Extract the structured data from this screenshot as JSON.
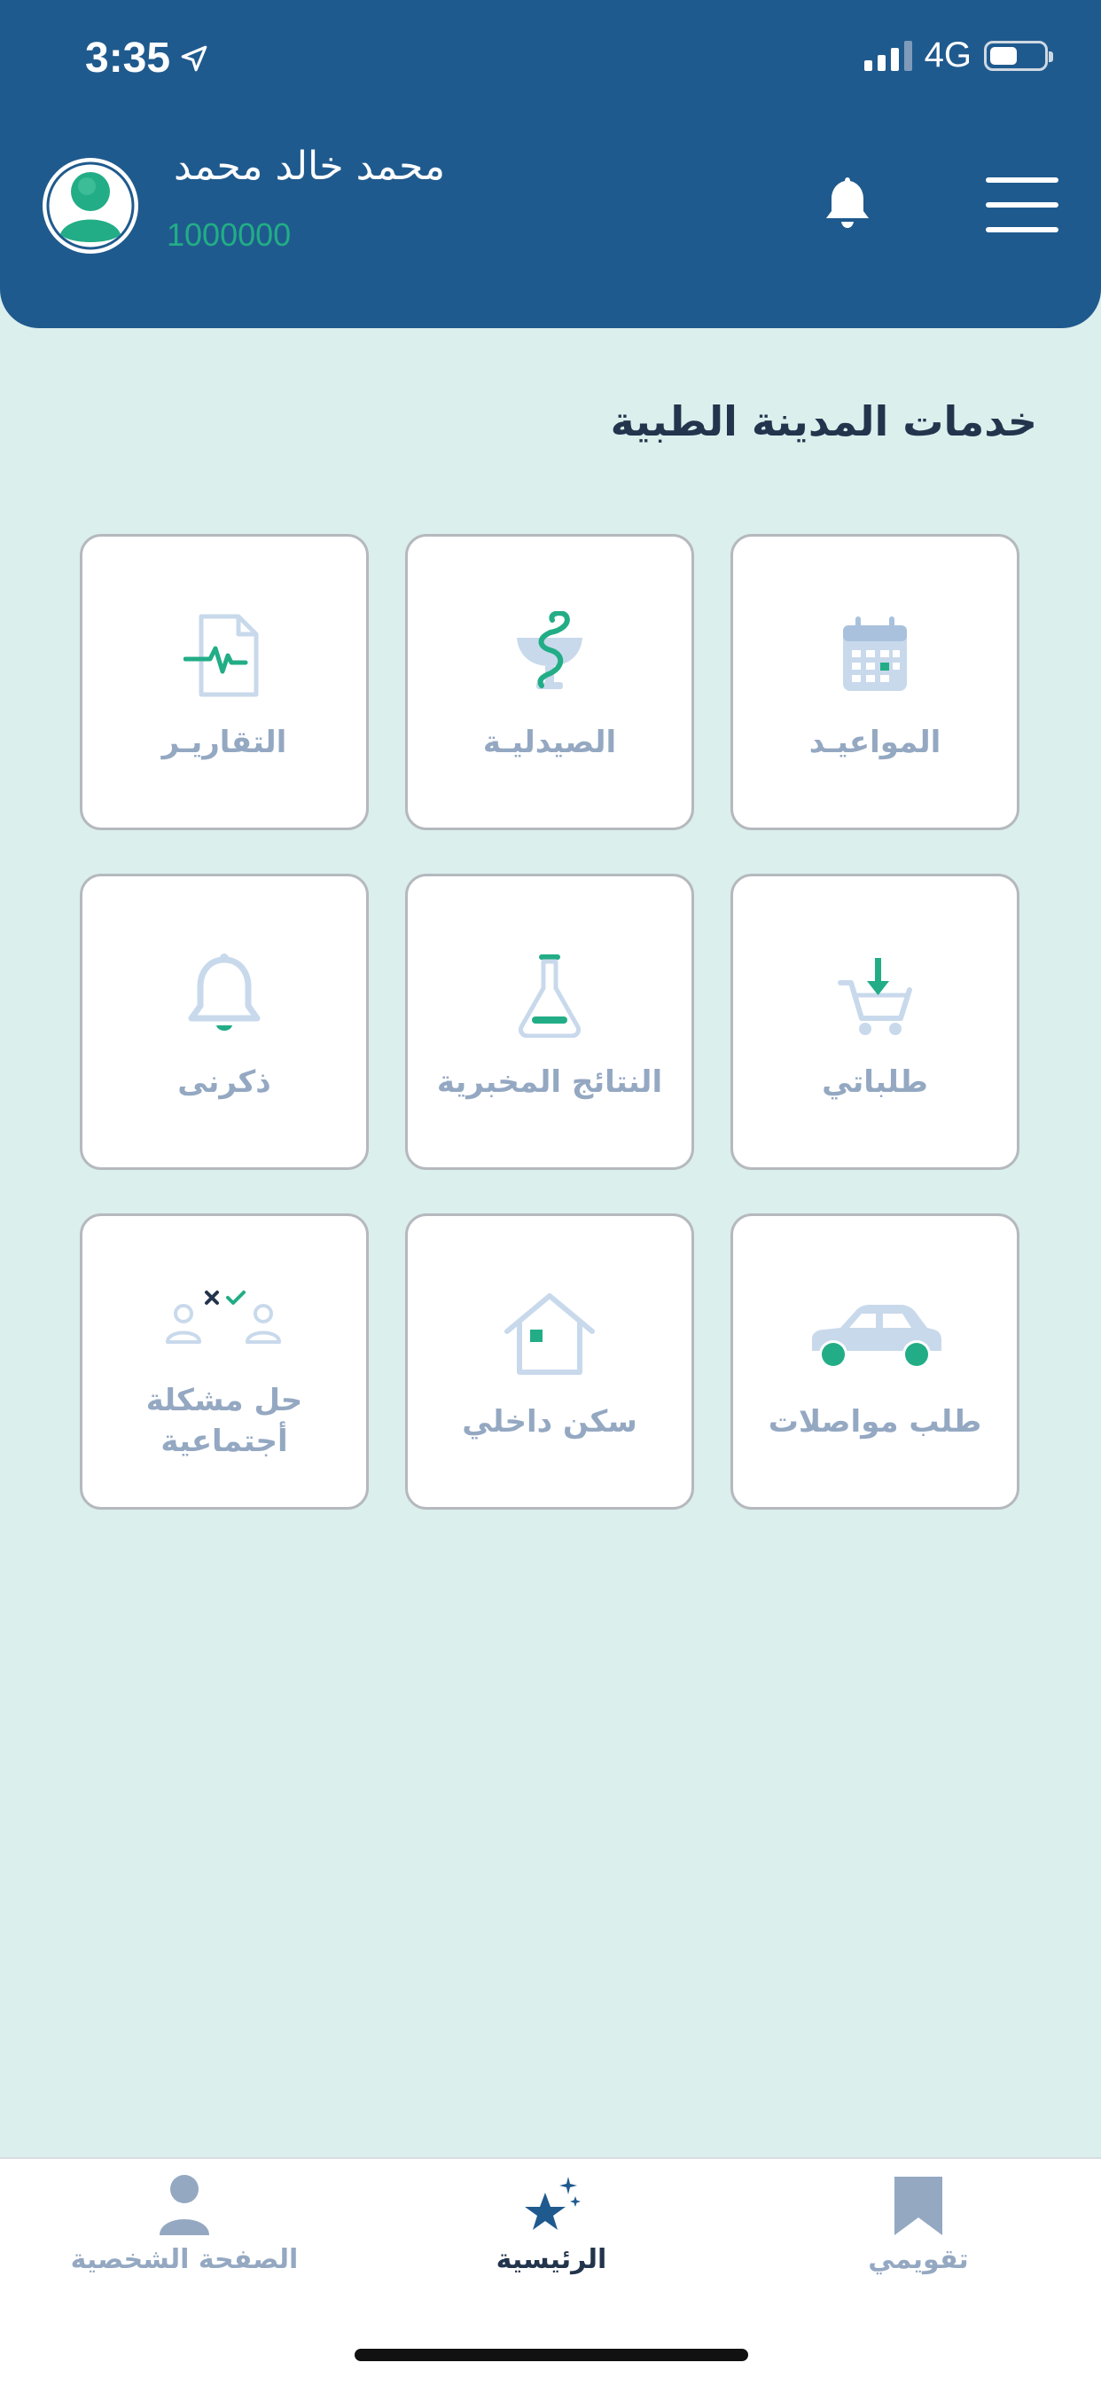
{
  "status_bar": {
    "time": "3:35",
    "network": "4G"
  },
  "header": {
    "user_name": "محمد خالد محمد",
    "user_id": "1000000"
  },
  "section_title": "خدمات المدينة الطبية",
  "services": [
    {
      "label": "المواعيـد",
      "icon": "calendar-icon"
    },
    {
      "label": "الصيدليـة",
      "icon": "pharmacy-icon"
    },
    {
      "label": "التقاريـر",
      "icon": "report-icon"
    },
    {
      "label": "طلباتي",
      "icon": "cart-icon"
    },
    {
      "label": "النتائج المخبرية",
      "icon": "lab-flask-icon"
    },
    {
      "label": "ذكرنى",
      "icon": "bell-icon"
    },
    {
      "label": "طلب مواصلات",
      "icon": "car-icon"
    },
    {
      "label": "سكن داخلي",
      "icon": "house-icon"
    },
    {
      "label_line1": "حل مشكلة",
      "label_line2": "أجتماعية",
      "icon": "social-problem-icon"
    }
  ],
  "bottom_nav": {
    "items": [
      {
        "label": "تقويمي",
        "icon": "bookmark-icon"
      },
      {
        "label": "الرئيسية",
        "icon": "stars-icon",
        "active": true
      },
      {
        "label": "الصفحة الشخصية",
        "icon": "person-icon"
      }
    ]
  },
  "colors": {
    "header_bg": "#1f5a8e",
    "page_bg": "#dbefed",
    "accent_green": "#22ad86",
    "icon_blue": "#c9d9ec",
    "label_gray": "#94a8c2",
    "title_dark": "#23354d"
  }
}
